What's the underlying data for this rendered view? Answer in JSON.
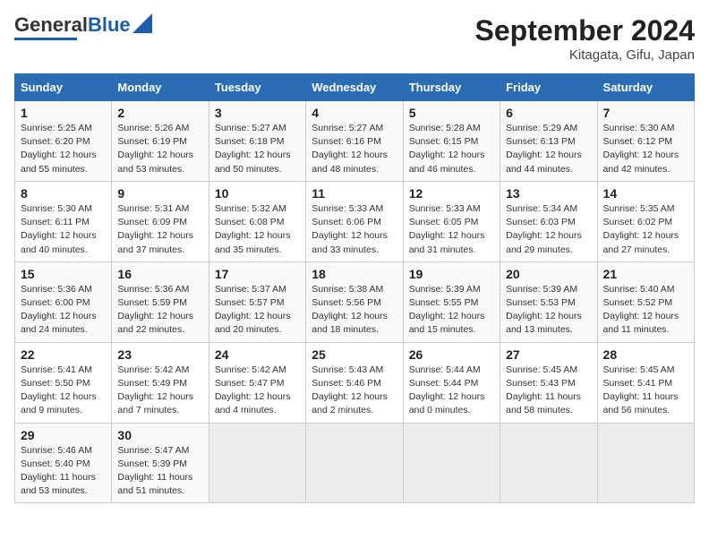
{
  "header": {
    "logo_general": "General",
    "logo_blue": "Blue",
    "month_title": "September 2024",
    "location": "Kitagata, Gifu, Japan"
  },
  "calendar": {
    "columns": [
      "Sunday",
      "Monday",
      "Tuesday",
      "Wednesday",
      "Thursday",
      "Friday",
      "Saturday"
    ],
    "weeks": [
      [
        {
          "day": "",
          "info": ""
        },
        {
          "day": "2",
          "info": "Sunrise: 5:26 AM\nSunset: 6:19 PM\nDaylight: 12 hours\nand 53 minutes."
        },
        {
          "day": "3",
          "info": "Sunrise: 5:27 AM\nSunset: 6:18 PM\nDaylight: 12 hours\nand 50 minutes."
        },
        {
          "day": "4",
          "info": "Sunrise: 5:27 AM\nSunset: 6:16 PM\nDaylight: 12 hours\nand 48 minutes."
        },
        {
          "day": "5",
          "info": "Sunrise: 5:28 AM\nSunset: 6:15 PM\nDaylight: 12 hours\nand 46 minutes."
        },
        {
          "day": "6",
          "info": "Sunrise: 5:29 AM\nSunset: 6:13 PM\nDaylight: 12 hours\nand 44 minutes."
        },
        {
          "day": "7",
          "info": "Sunrise: 5:30 AM\nSunset: 6:12 PM\nDaylight: 12 hours\nand 42 minutes."
        }
      ],
      [
        {
          "day": "1",
          "info": "Sunrise: 5:25 AM\nSunset: 6:20 PM\nDaylight: 12 hours\nand 55 minutes."
        },
        {
          "day": "",
          "info": "",
          "empty": true
        },
        {
          "day": "",
          "info": "",
          "empty": true
        },
        {
          "day": "",
          "info": "",
          "empty": true
        },
        {
          "day": "",
          "info": "",
          "empty": true
        },
        {
          "day": "",
          "info": "",
          "empty": true
        },
        {
          "day": "",
          "info": "",
          "empty": true
        }
      ],
      [
        {
          "day": "8",
          "info": "Sunrise: 5:30 AM\nSunset: 6:11 PM\nDaylight: 12 hours\nand 40 minutes."
        },
        {
          "day": "9",
          "info": "Sunrise: 5:31 AM\nSunset: 6:09 PM\nDaylight: 12 hours\nand 37 minutes."
        },
        {
          "day": "10",
          "info": "Sunrise: 5:32 AM\nSunset: 6:08 PM\nDaylight: 12 hours\nand 35 minutes."
        },
        {
          "day": "11",
          "info": "Sunrise: 5:33 AM\nSunset: 6:06 PM\nDaylight: 12 hours\nand 33 minutes."
        },
        {
          "day": "12",
          "info": "Sunrise: 5:33 AM\nSunset: 6:05 PM\nDaylight: 12 hours\nand 31 minutes."
        },
        {
          "day": "13",
          "info": "Sunrise: 5:34 AM\nSunset: 6:03 PM\nDaylight: 12 hours\nand 29 minutes."
        },
        {
          "day": "14",
          "info": "Sunrise: 5:35 AM\nSunset: 6:02 PM\nDaylight: 12 hours\nand 27 minutes."
        }
      ],
      [
        {
          "day": "15",
          "info": "Sunrise: 5:36 AM\nSunset: 6:00 PM\nDaylight: 12 hours\nand 24 minutes."
        },
        {
          "day": "16",
          "info": "Sunrise: 5:36 AM\nSunset: 5:59 PM\nDaylight: 12 hours\nand 22 minutes."
        },
        {
          "day": "17",
          "info": "Sunrise: 5:37 AM\nSunset: 5:57 PM\nDaylight: 12 hours\nand 20 minutes."
        },
        {
          "day": "18",
          "info": "Sunrise: 5:38 AM\nSunset: 5:56 PM\nDaylight: 12 hours\nand 18 minutes."
        },
        {
          "day": "19",
          "info": "Sunrise: 5:39 AM\nSunset: 5:55 PM\nDaylight: 12 hours\nand 15 minutes."
        },
        {
          "day": "20",
          "info": "Sunrise: 5:39 AM\nSunset: 5:53 PM\nDaylight: 12 hours\nand 13 minutes."
        },
        {
          "day": "21",
          "info": "Sunrise: 5:40 AM\nSunset: 5:52 PM\nDaylight: 12 hours\nand 11 minutes."
        }
      ],
      [
        {
          "day": "22",
          "info": "Sunrise: 5:41 AM\nSunset: 5:50 PM\nDaylight: 12 hours\nand 9 minutes."
        },
        {
          "day": "23",
          "info": "Sunrise: 5:42 AM\nSunset: 5:49 PM\nDaylight: 12 hours\nand 7 minutes."
        },
        {
          "day": "24",
          "info": "Sunrise: 5:42 AM\nSunset: 5:47 PM\nDaylight: 12 hours\nand 4 minutes."
        },
        {
          "day": "25",
          "info": "Sunrise: 5:43 AM\nSunset: 5:46 PM\nDaylight: 12 hours\nand 2 minutes."
        },
        {
          "day": "26",
          "info": "Sunrise: 5:44 AM\nSunset: 5:44 PM\nDaylight: 12 hours\nand 0 minutes."
        },
        {
          "day": "27",
          "info": "Sunrise: 5:45 AM\nSunset: 5:43 PM\nDaylight: 11 hours\nand 58 minutes."
        },
        {
          "day": "28",
          "info": "Sunrise: 5:45 AM\nSunset: 5:41 PM\nDaylight: 11 hours\nand 56 minutes."
        }
      ],
      [
        {
          "day": "29",
          "info": "Sunrise: 5:46 AM\nSunset: 5:40 PM\nDaylight: 11 hours\nand 53 minutes."
        },
        {
          "day": "30",
          "info": "Sunrise: 5:47 AM\nSunset: 5:39 PM\nDaylight: 11 hours\nand 51 minutes."
        },
        {
          "day": "",
          "info": "",
          "empty": true
        },
        {
          "day": "",
          "info": "",
          "empty": true
        },
        {
          "day": "",
          "info": "",
          "empty": true
        },
        {
          "day": "",
          "info": "",
          "empty": true
        },
        {
          "day": "",
          "info": "",
          "empty": true
        }
      ]
    ]
  }
}
